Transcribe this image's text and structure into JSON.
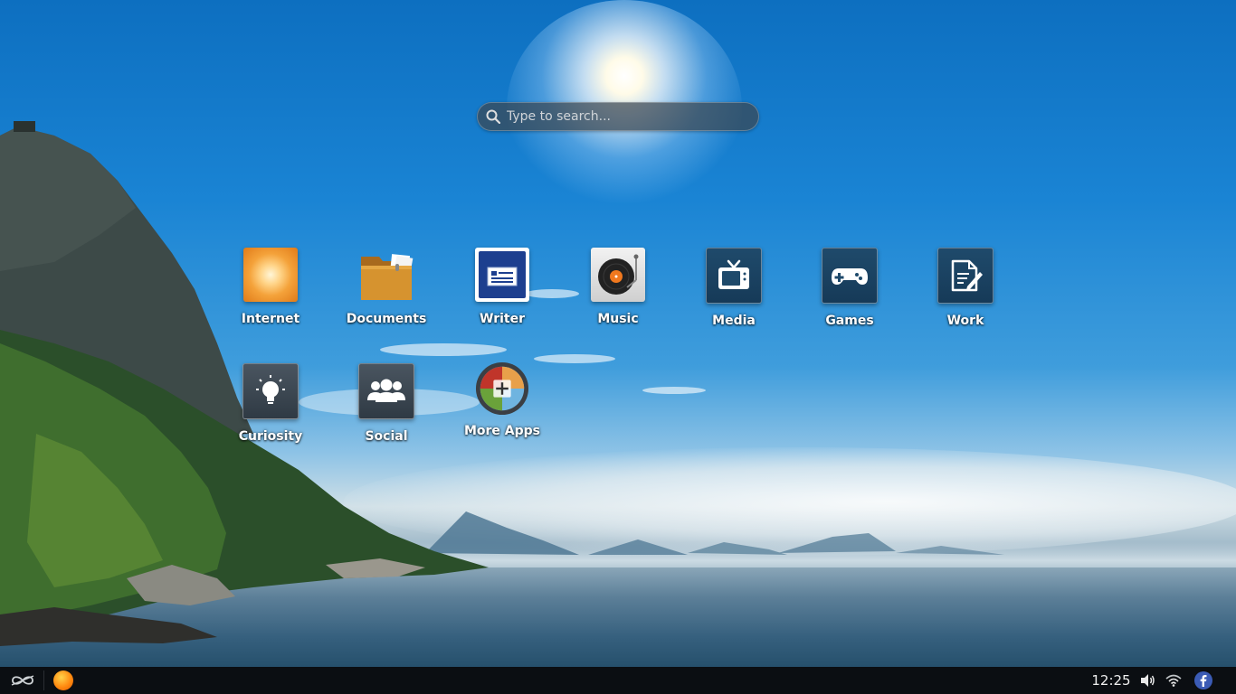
{
  "search": {
    "placeholder": "Type to search..."
  },
  "apps": [
    {
      "label": "Internet",
      "icon": "internet-icon"
    },
    {
      "label": "Documents",
      "icon": "folder-icon"
    },
    {
      "label": "Writer",
      "icon": "writer-icon"
    },
    {
      "label": "Music",
      "icon": "turntable-icon"
    },
    {
      "label": "Media",
      "icon": "tv-icon"
    },
    {
      "label": "Games",
      "icon": "gamepad-icon"
    },
    {
      "label": "Work",
      "icon": "document-edit-icon"
    },
    {
      "label": "Curiosity",
      "icon": "lightbulb-icon"
    },
    {
      "label": "Social",
      "icon": "people-icon"
    },
    {
      "label": "More Apps",
      "icon": "app-store-icon"
    }
  ],
  "taskbar": {
    "clock": "12:25",
    "icons": [
      "endless-logo-icon",
      "browser-icon",
      "volume-icon",
      "wifi-icon",
      "facebook-icon"
    ]
  },
  "colors": {
    "taskbar_bg": "#0b0e12",
    "tile_dark": "#1f4a6b",
    "internet_orange": "#f08a20",
    "writer_blue": "#1d3f8f"
  }
}
